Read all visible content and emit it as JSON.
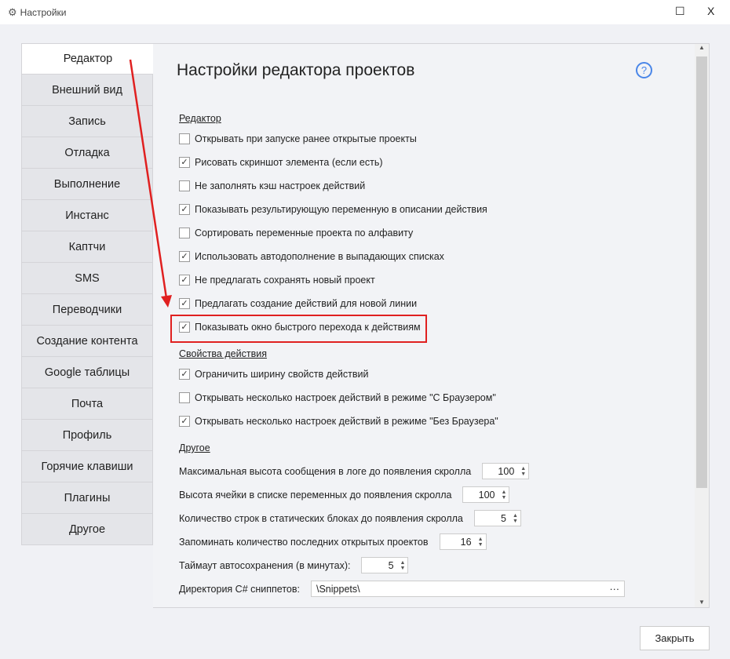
{
  "window": {
    "title": "Настройки",
    "maximize": "☐",
    "close": "X"
  },
  "tabs": [
    "Редактор",
    "Внешний вид",
    "Запись",
    "Отладка",
    "Выполнение",
    "Инстанс",
    "Каптчи",
    "SMS",
    "Переводчики",
    "Создание контента",
    "Google таблицы",
    "Почта",
    "Профиль",
    "Горячие клавиши",
    "Плагины",
    "Другое"
  ],
  "main": {
    "title": "Настройки редактора проектов",
    "help": "?",
    "sections": {
      "editor": "Редактор",
      "action_props": "Свойства действия",
      "other": "Другое"
    },
    "editor_options": [
      {
        "label": "Открывать при запуске ранее открытые проекты",
        "checked": false
      },
      {
        "label": "Рисовать скриншот элемента (если есть)",
        "checked": true
      },
      {
        "label": "Не заполнять кэш настроек действий",
        "checked": false
      },
      {
        "label": "Показывать результирующую переменную в описании действия",
        "checked": true
      },
      {
        "label": "Сортировать переменные проекта по алфавиту",
        "checked": false
      },
      {
        "label": "Использовать автодополнение в выпадающих списках",
        "checked": true
      },
      {
        "label": "Не предлагать сохранять новый проект",
        "checked": true
      },
      {
        "label": "Предлагать создание действий для новой линии",
        "checked": true
      },
      {
        "label": "Показывать окно быстрого перехода к действиям",
        "checked": true
      }
    ],
    "action_options": [
      {
        "label": "Ограничить ширину свойств действий",
        "checked": true
      },
      {
        "label": "Открывать несколько настроек действий в режиме \"С Браузером\"",
        "checked": false
      },
      {
        "label": "Открывать несколько настроек действий в режиме \"Без Браузера\"",
        "checked": true
      }
    ],
    "other_fields": [
      {
        "label": "Максимальная высота сообщения в логе до появления скролла",
        "value": "100"
      },
      {
        "label": "Высота ячейки в списке переменных до появления скролла",
        "value": "100"
      },
      {
        "label": "Количество строк в статических блоках до появления скролла",
        "value": "5"
      },
      {
        "label": "Запоминать количество последних открытых проектов",
        "value": "16"
      },
      {
        "label": "Таймаут автосохранения (в минутах):",
        "value": "5"
      }
    ],
    "snippets": {
      "label": "Директория C# сниппетов:",
      "value": "\\Snippets\\",
      "browse": "···"
    }
  },
  "footer": {
    "close": "Закрыть"
  }
}
